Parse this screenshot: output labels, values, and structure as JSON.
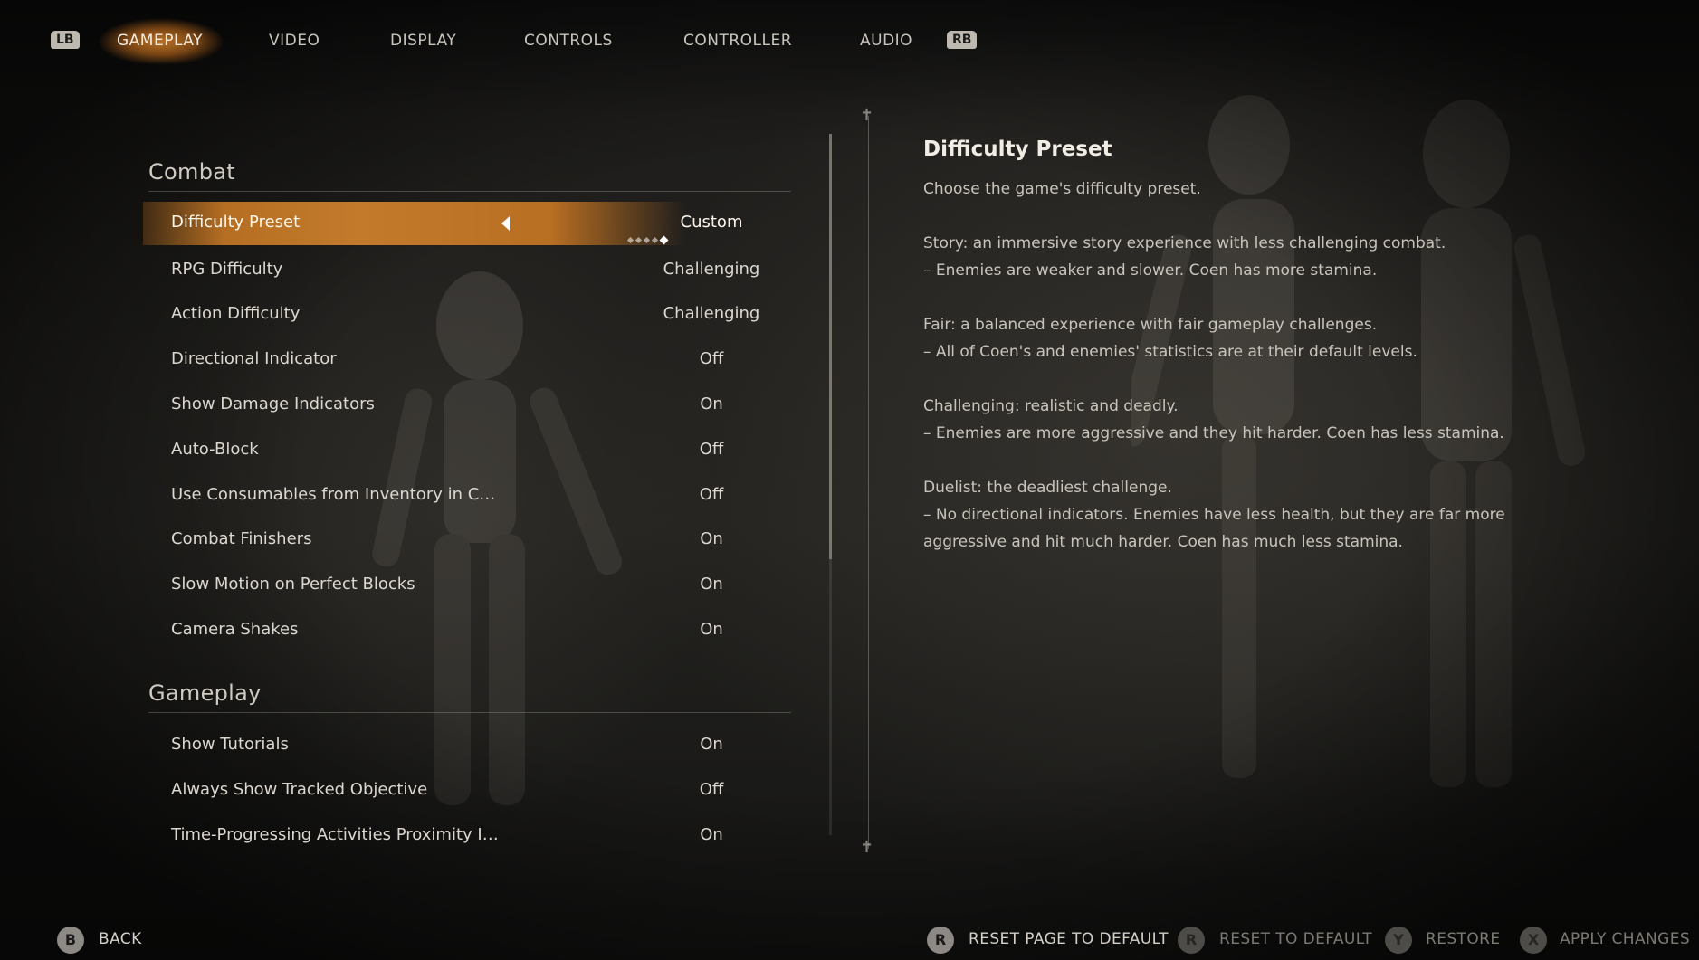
{
  "tabs": {
    "lb": "LB",
    "rb": "RB",
    "items": [
      {
        "label": "GAMEPLAY",
        "active": true
      },
      {
        "label": "VIDEO"
      },
      {
        "label": "DISPLAY"
      },
      {
        "label": "CONTROLS"
      },
      {
        "label": "CONTROLLER"
      },
      {
        "label": "AUDIO"
      }
    ]
  },
  "sections": {
    "combat": {
      "title": "Combat",
      "rows": [
        {
          "label": "Difficulty Preset",
          "value": "Custom",
          "selected": true
        },
        {
          "label": "RPG Difficulty",
          "value": "Challenging"
        },
        {
          "label": "Action Difficulty",
          "value": "Challenging"
        },
        {
          "label": "Directional Indicator",
          "value": "Off"
        },
        {
          "label": "Show Damage Indicators",
          "value": "On"
        },
        {
          "label": "Auto-Block",
          "value": "Off"
        },
        {
          "label": "Use Consumables from Inventory in C…",
          "value": "Off"
        },
        {
          "label": "Combat Finishers",
          "value": "On"
        },
        {
          "label": "Slow Motion on Perfect Blocks",
          "value": "On"
        },
        {
          "label": "Camera Shakes",
          "value": "On"
        }
      ]
    },
    "gameplay": {
      "title": "Gameplay",
      "rows": [
        {
          "label": "Show Tutorials",
          "value": "On"
        },
        {
          "label": "Always Show Tracked Objective",
          "value": "Off"
        },
        {
          "label": "Time-Progressing Activities Proximity I…",
          "value": "On"
        }
      ]
    }
  },
  "preset_dots": {
    "count": 5,
    "active_index": 4
  },
  "description": {
    "title": "Difficulty Preset",
    "intro": "Choose the game's difficulty preset.",
    "story": "Story: an immersive story experience with less challenging combat.",
    "story_detail": "– Enemies are weaker and slower. Coen has more stamina.",
    "fair": "Fair: a balanced experience with fair gameplay challenges.",
    "fair_detail": "– All of Coen's and enemies' statistics are at their default levels.",
    "challenging": "Challenging: realistic and deadly.",
    "challenging_detail": "– Enemies are more aggressive and they hit harder. Coen has less stamina.",
    "duelist": "Duelist: the deadliest challenge.",
    "duelist_detail": "– No directional indicators. Enemies have less health, but they are far more aggressive and hit much harder. Coen has much less stamina."
  },
  "footer": {
    "back": {
      "glyph": "B",
      "label": "BACK"
    },
    "reset_page": {
      "glyph": "R",
      "label": "RESET PAGE TO DEFAULT"
    },
    "reset": {
      "glyph": "R",
      "label": "RESET TO DEFAULT"
    },
    "restore": {
      "glyph": "Y",
      "label": "RESTORE"
    },
    "apply": {
      "glyph": "X",
      "label": "APPLY CHANGES"
    }
  }
}
